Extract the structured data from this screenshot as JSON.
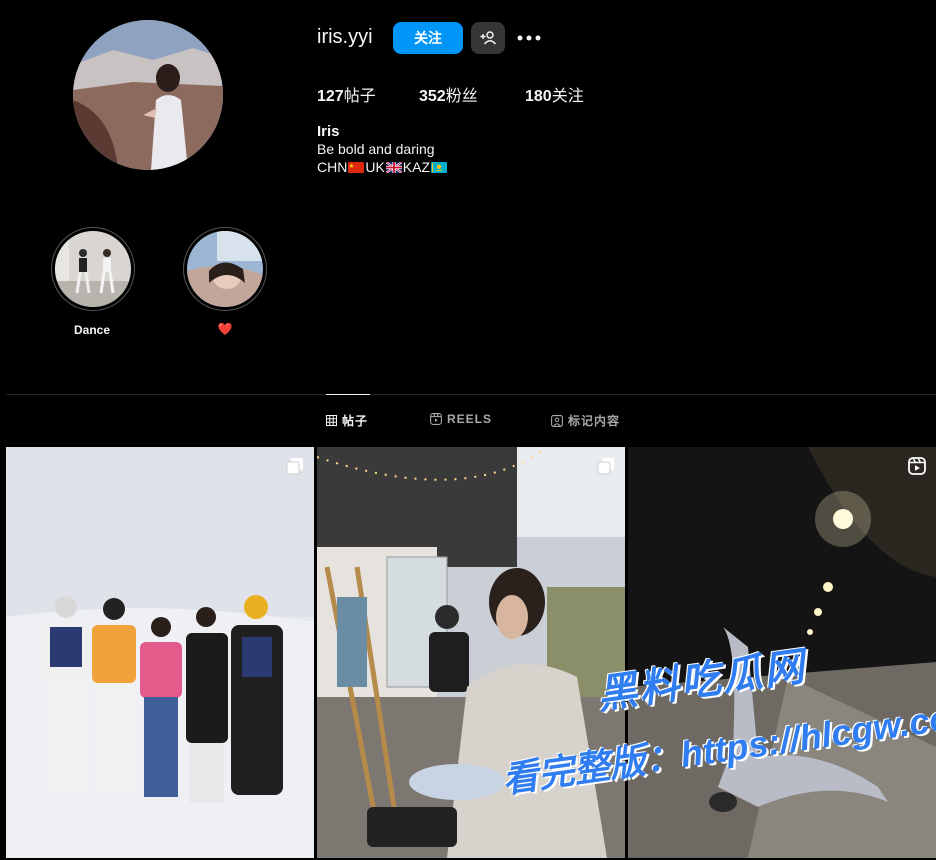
{
  "profile": {
    "username": "iris.yyi",
    "follow_label": "关注",
    "add_user_icon": "add-user-icon",
    "more_icon": "more-icon",
    "stats": {
      "posts_count": "127",
      "posts_label": "帖子",
      "followers_count": "352",
      "followers_label": "粉丝",
      "following_count": "180",
      "following_label": "关注"
    },
    "full_name": "Iris",
    "bio_line1": "Be bold and daring",
    "bio_line2": {
      "part1": "CHN",
      "part2": "UK",
      "part3": "KAZ"
    }
  },
  "highlights": [
    {
      "label": "Dance"
    },
    {
      "label": "❤️"
    }
  ],
  "tabs": [
    {
      "label": "帖子",
      "icon": "grid-icon",
      "active": true
    },
    {
      "label": "REELS",
      "icon": "reels-icon",
      "active": false
    },
    {
      "label": "标记内容",
      "icon": "tagged-icon",
      "active": false
    }
  ],
  "posts": [
    {
      "type": "carousel",
      "icon": "carousel-icon"
    },
    {
      "type": "carousel",
      "icon": "carousel-icon"
    },
    {
      "type": "reel",
      "icon": "reel-icon"
    }
  ],
  "watermark": {
    "line1": "黑料吃瓜网",
    "line2": "看完整版：https://hlcgw.co"
  },
  "colors": {
    "accent": "#0095f6",
    "background": "#000000",
    "muted": "#a8a8a8"
  }
}
